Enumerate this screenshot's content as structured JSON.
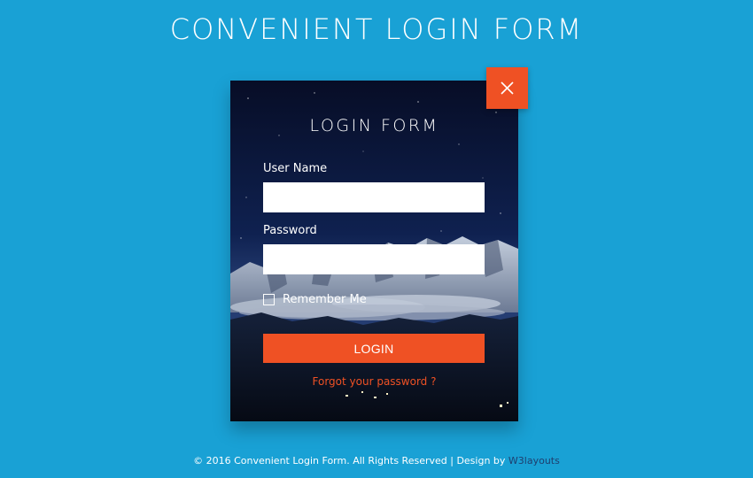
{
  "page": {
    "title": "CONVENIENT LOGIN FORM",
    "background_color": "#19a1d5",
    "accent_color": "#ef5124"
  },
  "close_button": {
    "icon": "close-icon"
  },
  "form": {
    "title": "LOGIN FORM",
    "username": {
      "label": "User Name",
      "value": "",
      "placeholder": ""
    },
    "password": {
      "label": "Password",
      "value": "",
      "placeholder": ""
    },
    "remember": {
      "label": "Remember Me",
      "checked": false
    },
    "login_button_label": "LOGIN",
    "forgot_link": "Forgot your password ?"
  },
  "footer": {
    "text": "© 2016 Convenient Login Form. All Rights Reserved | Design by ",
    "link_text": "W3layouts",
    "link_color": "#1f3e6e"
  }
}
